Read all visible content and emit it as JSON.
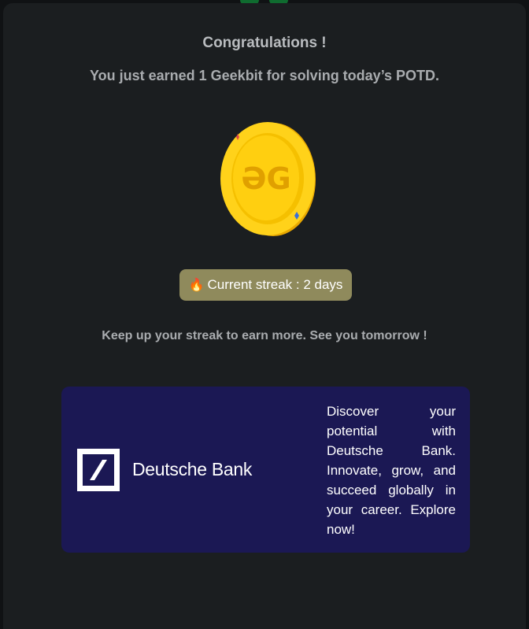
{
  "modal": {
    "title": "Congratulations !",
    "subtitle": "You just earned 1 Geekbit for solving today’s POTD.",
    "coin_icon": "geekbit-coin-icon",
    "streak": {
      "icon": "fire-icon",
      "label": "Current streak : 2 days"
    },
    "message": "Keep up your streak to earn more. See you tomorrow !"
  },
  "ad": {
    "brand_name": "Deutsche Bank",
    "logo_icon": "deutsche-bank-logo",
    "text": "Discover your potential with Deutsche Bank. Innovate, grow, and succeed globally in your career. Explore now!"
  },
  "colors": {
    "modal_bg": "#1b1e20",
    "streak_bg": "#8f8a5c",
    "ad_bg": "#1b1854",
    "coin": "#f5c400"
  }
}
